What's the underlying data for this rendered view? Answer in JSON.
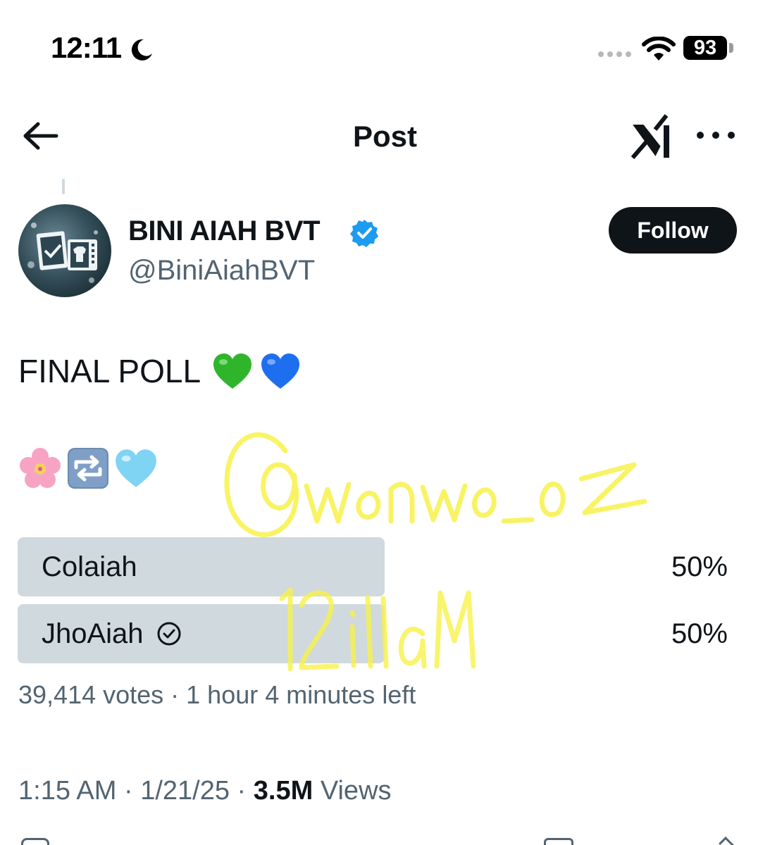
{
  "status_bar": {
    "time": "12:11",
    "battery": "93",
    "icons": [
      "moon-icon",
      "signal-dots-icon",
      "wifi-icon",
      "battery-icon"
    ]
  },
  "header": {
    "title": "Post",
    "icons": [
      "back-arrow-icon",
      "grok-icon",
      "more-options-icon"
    ]
  },
  "author": {
    "name": "BINI AIAH BVT",
    "handle": "@BiniAiahBVT",
    "verified": true,
    "follow_label": "Follow"
  },
  "post": {
    "text": "FINAL POLL",
    "text_emojis": [
      "green-heart-icon",
      "blue-heart-icon"
    ],
    "emoji_row": [
      "cherry-blossom-icon",
      "repeat-button-icon",
      "light-blue-heart-icon"
    ]
  },
  "poll": {
    "options": [
      {
        "label": "Colaiah",
        "percent": "50%",
        "share": 0.5,
        "voted": false
      },
      {
        "label": "JhoAiah",
        "percent": "50%",
        "share": 0.5,
        "voted": true
      }
    ],
    "votes": "39,414 votes",
    "separator": " · ",
    "time_left": "1 hour 4 minutes left"
  },
  "footer": {
    "time": "1:15 AM",
    "date": "1/21/25",
    "separator": " · ",
    "views_count": "3.5M",
    "views_label": "Views"
  },
  "watermark": {
    "handle": "@wonwo_oz",
    "signature": "12illaM",
    "color": "#f7f24a"
  },
  "colors": {
    "text_primary": "#0f1419",
    "text_secondary": "#536471",
    "poll_bar": "#cfd9de",
    "verified_blue": "#1d9bf0",
    "follow_bg": "#0f1419"
  }
}
